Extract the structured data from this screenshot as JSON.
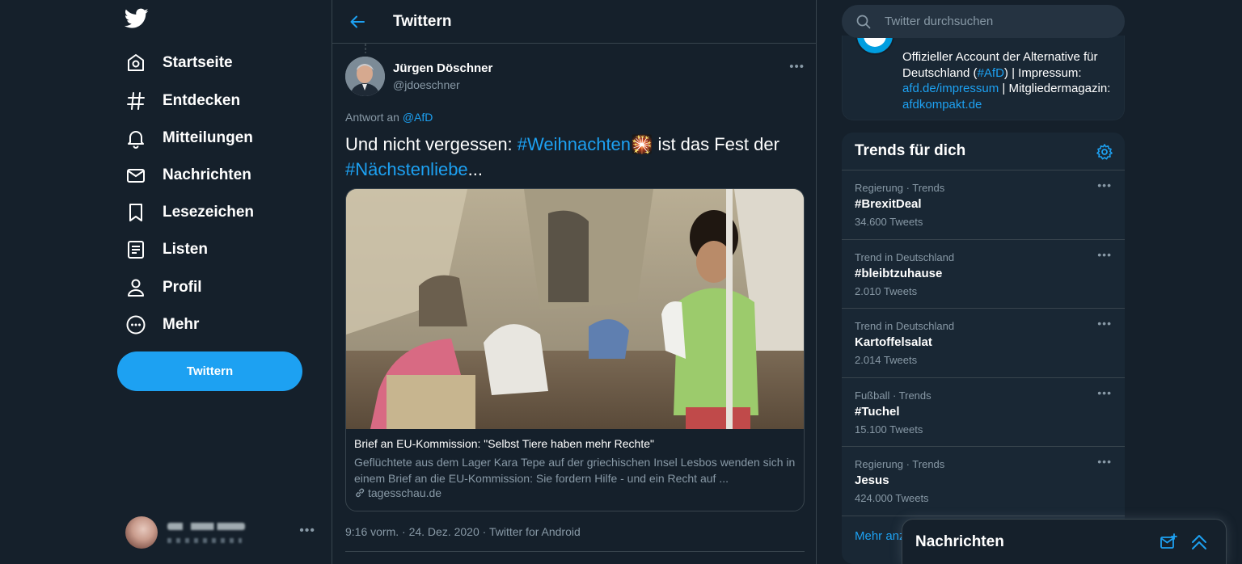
{
  "nav": {
    "items": [
      {
        "label": "Startseite",
        "icon": "home-icon"
      },
      {
        "label": "Entdecken",
        "icon": "hashtag-icon"
      },
      {
        "label": "Mitteilungen",
        "icon": "bell-icon"
      },
      {
        "label": "Nachrichten",
        "icon": "mail-icon"
      },
      {
        "label": "Lesezeichen",
        "icon": "bookmark-icon"
      },
      {
        "label": "Listen",
        "icon": "list-icon"
      },
      {
        "label": "Profil",
        "icon": "person-icon"
      },
      {
        "label": "Mehr",
        "icon": "more-circle-icon"
      }
    ],
    "tweet_button": "Twittern",
    "account_more": "•••"
  },
  "main": {
    "title": "Twittern",
    "tweet": {
      "author_name": "Jürgen Döschner",
      "author_handle": "@jdoeschner",
      "more": "•••",
      "reply_prefix": "Antwort an",
      "reply_to": "@AfD",
      "text_part1": "Und nicht vergessen: ",
      "hashtag1": "#Weihnachten",
      "emoji": "🎇",
      "text_part2": " ist das Fest der ",
      "hashtag2": "#Nächstenliebe",
      "text_part3": "...",
      "card": {
        "title": "Brief an EU-Kommission: \"Selbst Tiere haben mehr Rechte\"",
        "description": "Geflüchtete aus dem Lager Kara Tepe auf der griechischen Insel Lesbos wenden sich in einem Brief an die EU-Kommission: Sie fordern Hilfe - und ein Recht auf ...",
        "domain": "tagesschau.de"
      },
      "meta": "9:16 vorm. · 24. Dez. 2020 · Twitter for Android"
    }
  },
  "right": {
    "search_placeholder": "Twitter durchsuchen",
    "profile": {
      "bio_part1": "Offizieller Account der Alternative für Deutschland (",
      "bio_tag": "#AfD",
      "bio_part2": ") | Impressum: ",
      "bio_link1": "afd.de/impressum",
      "bio_part3": " | Mitgliedermagazin: ",
      "bio_link2": "afdkompakt.de"
    },
    "trends_title": "Trends für dich",
    "trends": [
      {
        "category": "Regierung · Trends",
        "name": "#BrexitDeal",
        "count": "34.600 Tweets"
      },
      {
        "category": "Trend in Deutschland",
        "name": "#bleibtzuhause",
        "count": "2.010 Tweets"
      },
      {
        "category": "Trend in Deutschland",
        "name": "Kartoffelsalat",
        "count": "2.014 Tweets"
      },
      {
        "category": "Fußball · Trends",
        "name": "#Tuchel",
        "count": "15.100 Tweets"
      },
      {
        "category": "Regierung · Trends",
        "name": "Jesus",
        "count": "424.000 Tweets"
      }
    ],
    "trend_more": "•••",
    "show_more": "Mehr anzeigen"
  },
  "dock": {
    "title": "Nachrichten"
  },
  "colors": {
    "background": "#15202b",
    "accent": "#1da1f2",
    "secondary_text": "#8899a6",
    "border": "#38444d"
  }
}
